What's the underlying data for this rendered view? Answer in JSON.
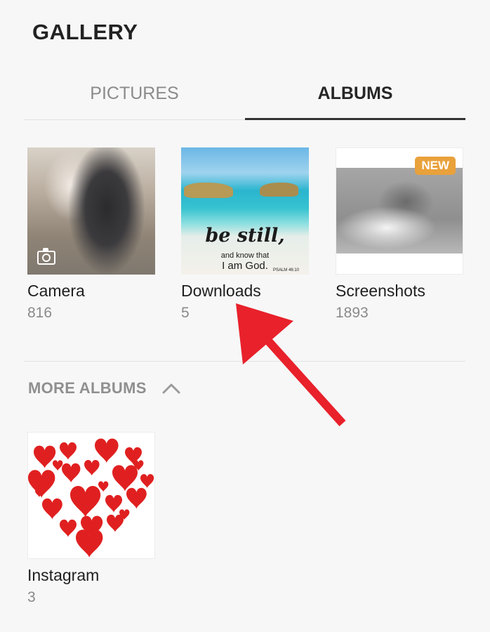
{
  "app": {
    "title": "GALLERY"
  },
  "tabs": [
    {
      "label": "PICTURES",
      "active": false
    },
    {
      "label": "ALBUMS",
      "active": true
    }
  ],
  "albums": [
    {
      "name": "Camera",
      "count": "816"
    },
    {
      "name": "Downloads",
      "count": "5"
    },
    {
      "name": "Screenshots",
      "count": "1893",
      "badge": "NEW"
    }
  ],
  "downloads_thumb_text": {
    "line1": "be still,",
    "line2": "and know that",
    "line3": "I am God.",
    "line4": "PSALM 46:10"
  },
  "more_albums": {
    "label": "MORE ALBUMS",
    "expanded": true,
    "icon": "chevron-up-icon",
    "items": [
      {
        "name": "Instagram",
        "count": "3"
      }
    ]
  },
  "colors": {
    "accent_badge": "#e9a13b",
    "annotation_arrow": "#e8212b",
    "tab_indicator": "#333333"
  }
}
